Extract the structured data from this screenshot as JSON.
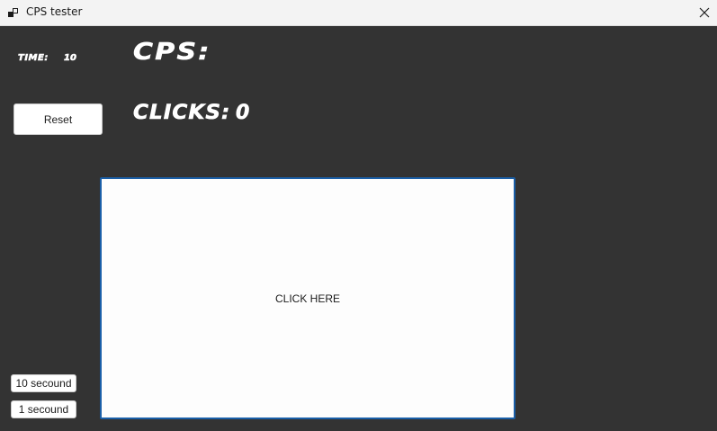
{
  "window": {
    "title": "CPS tester",
    "icon": "app-window-icon",
    "close_icon": "close-icon"
  },
  "stats": {
    "time_label": "TIME:",
    "time_value": "10",
    "cps_label": "CPS:",
    "cps_value": "",
    "clicks_label": "CLICKS:",
    "clicks_value": "0"
  },
  "buttons": {
    "reset_label": "Reset",
    "ten_seconds_label": "10 secound",
    "one_second_label": "1 secound"
  },
  "click_area": {
    "label": "CLICK HERE"
  },
  "colors": {
    "background": "#333333",
    "accent_border": "#1a5fa8",
    "text_light": "#ffffff"
  }
}
